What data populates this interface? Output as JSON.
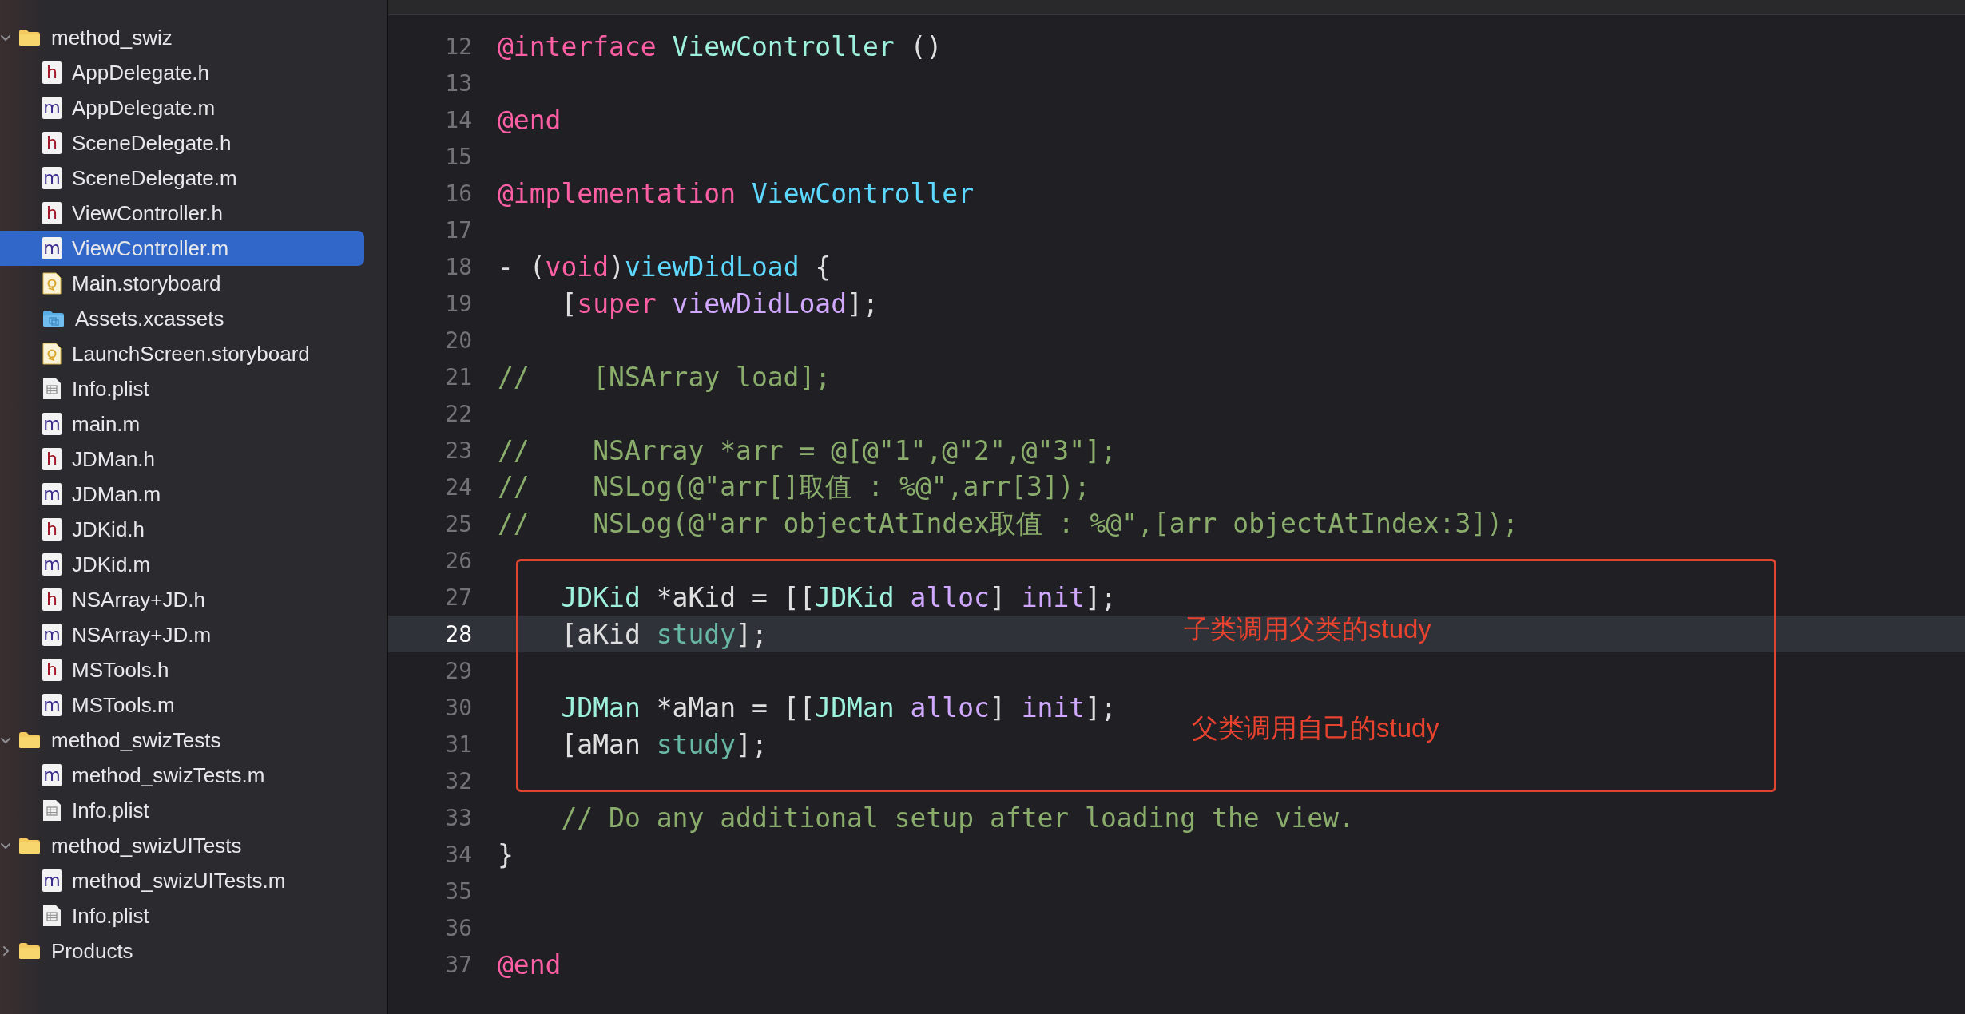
{
  "navigator": {
    "items": [
      {
        "name": "method_swiz",
        "kind": "folder",
        "expanded": true,
        "selected": false,
        "children": [
          {
            "name": "AppDelegate.h",
            "kind": "header",
            "icon_letter": "h",
            "selected": false
          },
          {
            "name": "AppDelegate.m",
            "kind": "source",
            "icon_letter": "m",
            "selected": false
          },
          {
            "name": "SceneDelegate.h",
            "kind": "header",
            "icon_letter": "h",
            "selected": false
          },
          {
            "name": "SceneDelegate.m",
            "kind": "source",
            "icon_letter": "m",
            "selected": false
          },
          {
            "name": "ViewController.h",
            "kind": "header",
            "icon_letter": "h",
            "selected": false
          },
          {
            "name": "ViewController.m",
            "kind": "source",
            "icon_letter": "m",
            "selected": true
          },
          {
            "name": "Main.storyboard",
            "kind": "storyboard",
            "selected": false
          },
          {
            "name": "Assets.xcassets",
            "kind": "assets",
            "selected": false
          },
          {
            "name": "LaunchScreen.storyboard",
            "kind": "storyboard",
            "selected": false
          },
          {
            "name": "Info.plist",
            "kind": "plist",
            "selected": false
          },
          {
            "name": "main.m",
            "kind": "source",
            "icon_letter": "m",
            "selected": false
          },
          {
            "name": "JDMan.h",
            "kind": "header",
            "icon_letter": "h",
            "selected": false
          },
          {
            "name": "JDMan.m",
            "kind": "source",
            "icon_letter": "m",
            "selected": false
          },
          {
            "name": "JDKid.h",
            "kind": "header",
            "icon_letter": "h",
            "selected": false
          },
          {
            "name": "JDKid.m",
            "kind": "source",
            "icon_letter": "m",
            "selected": false
          },
          {
            "name": "NSArray+JD.h",
            "kind": "header",
            "icon_letter": "h",
            "selected": false
          },
          {
            "name": "NSArray+JD.m",
            "kind": "source",
            "icon_letter": "m",
            "selected": false
          },
          {
            "name": "MSTools.h",
            "kind": "header",
            "icon_letter": "h",
            "selected": false
          },
          {
            "name": "MSTools.m",
            "kind": "source",
            "icon_letter": "m",
            "selected": false
          }
        ]
      },
      {
        "name": "method_swizTests",
        "kind": "folder",
        "expanded": true,
        "selected": false,
        "children": [
          {
            "name": "method_swizTests.m",
            "kind": "source",
            "icon_letter": "m",
            "selected": false
          },
          {
            "name": "Info.plist",
            "kind": "plist",
            "selected": false
          }
        ]
      },
      {
        "name": "method_swizUITests",
        "kind": "folder",
        "expanded": true,
        "selected": false,
        "children": [
          {
            "name": "method_swizUITests.m",
            "kind": "source",
            "icon_letter": "m",
            "selected": false
          },
          {
            "name": "Info.plist",
            "kind": "plist",
            "selected": false
          }
        ]
      },
      {
        "name": "Products",
        "kind": "folder",
        "expanded": false,
        "selected": false
      }
    ]
  },
  "code_editor": {
    "lines": [
      {
        "number": "12",
        "current": false,
        "tokens": [
          {
            "text": "@interface ",
            "kind": "keyword"
          },
          {
            "text": "ViewController",
            "kind": "type"
          },
          {
            "text": " ()",
            "kind": "plain"
          }
        ]
      },
      {
        "number": "13",
        "current": false
      },
      {
        "number": "14",
        "current": false,
        "tokens": [
          {
            "text": "@end",
            "kind": "keyword"
          }
        ]
      },
      {
        "number": "15",
        "current": false
      },
      {
        "number": "16",
        "current": false,
        "tokens": [
          {
            "text": "@implementation ",
            "kind": "keyword"
          },
          {
            "text": "ViewController",
            "kind": "declaration"
          }
        ]
      },
      {
        "number": "17",
        "current": false
      },
      {
        "number": "18",
        "current": false,
        "tokens": [
          {
            "text": "- (",
            "kind": "plain"
          },
          {
            "text": "void",
            "kind": "keyword"
          },
          {
            "text": ")",
            "kind": "plain"
          },
          {
            "text": "viewDidLoad",
            "kind": "declaration"
          },
          {
            "text": " {",
            "kind": "plain"
          }
        ]
      },
      {
        "number": "19",
        "current": false,
        "tokens": [
          {
            "text": "    [",
            "kind": "plain"
          },
          {
            "text": "super",
            "kind": "keyword"
          },
          {
            "text": " viewDidLoad",
            "kind": "method"
          },
          {
            "text": "];",
            "kind": "plain"
          }
        ]
      },
      {
        "number": "20",
        "current": false
      },
      {
        "number": "21",
        "current": false,
        "tokens": [
          {
            "text": "//    [NSArray load];",
            "kind": "comment"
          }
        ]
      },
      {
        "number": "22",
        "current": false
      },
      {
        "number": "23",
        "current": false,
        "tokens": [
          {
            "text": "//    NSArray *arr = @[@\"1\",@\"2\",@\"3\"];",
            "kind": "comment"
          }
        ]
      },
      {
        "number": "24",
        "current": false,
        "tokens": [
          {
            "text": "//    NSLog(@\"arr[]取值 : %@\",arr[3]);",
            "kind": "comment"
          }
        ]
      },
      {
        "number": "25",
        "current": false,
        "tokens": [
          {
            "text": "//    NSLog(@\"arr objectAtIndex取值 : %@\",[arr objectAtIndex:3]);",
            "kind": "comment"
          }
        ]
      },
      {
        "number": "26",
        "current": false
      },
      {
        "number": "27",
        "current": false,
        "tokens": [
          {
            "text": "    JDKid",
            "kind": "type"
          },
          {
            "text": " *aKid = [[",
            "kind": "plain"
          },
          {
            "text": "JDKid",
            "kind": "type"
          },
          {
            "text": " alloc",
            "kind": "method"
          },
          {
            "text": "] ",
            "kind": "plain"
          },
          {
            "text": "init",
            "kind": "method"
          },
          {
            "text": "];",
            "kind": "plain"
          }
        ]
      },
      {
        "number": "28",
        "current": true,
        "tokens": [
          {
            "text": "    [aKid ",
            "kind": "plain"
          },
          {
            "text": "study",
            "kind": "project_method"
          },
          {
            "text": "];",
            "kind": "plain"
          }
        ]
      },
      {
        "number": "29",
        "current": false
      },
      {
        "number": "30",
        "current": false,
        "tokens": [
          {
            "text": "    JDMan",
            "kind": "type"
          },
          {
            "text": " *aMan = [[",
            "kind": "plain"
          },
          {
            "text": "JDMan",
            "kind": "type"
          },
          {
            "text": " alloc",
            "kind": "method"
          },
          {
            "text": "] ",
            "kind": "plain"
          },
          {
            "text": "init",
            "kind": "method"
          },
          {
            "text": "];",
            "kind": "plain"
          }
        ]
      },
      {
        "number": "31",
        "current": false,
        "tokens": [
          {
            "text": "    [aMan ",
            "kind": "plain"
          },
          {
            "text": "study",
            "kind": "project_method"
          },
          {
            "text": "];",
            "kind": "plain"
          }
        ]
      },
      {
        "number": "32",
        "current": false
      },
      {
        "number": "33",
        "current": false,
        "tokens": [
          {
            "text": "    // Do any additional setup after loading the view.",
            "kind": "comment"
          }
        ]
      },
      {
        "number": "34",
        "current": false,
        "tokens": [
          {
            "text": "}",
            "kind": "plain"
          }
        ]
      },
      {
        "number": "35",
        "current": false
      },
      {
        "number": "36",
        "current": false
      },
      {
        "number": "37",
        "current": false,
        "tokens": [
          {
            "text": "@end",
            "kind": "keyword"
          }
        ]
      }
    ],
    "annotations": [
      "子类调用父类的study",
      "父类调用自己的study"
    ]
  }
}
